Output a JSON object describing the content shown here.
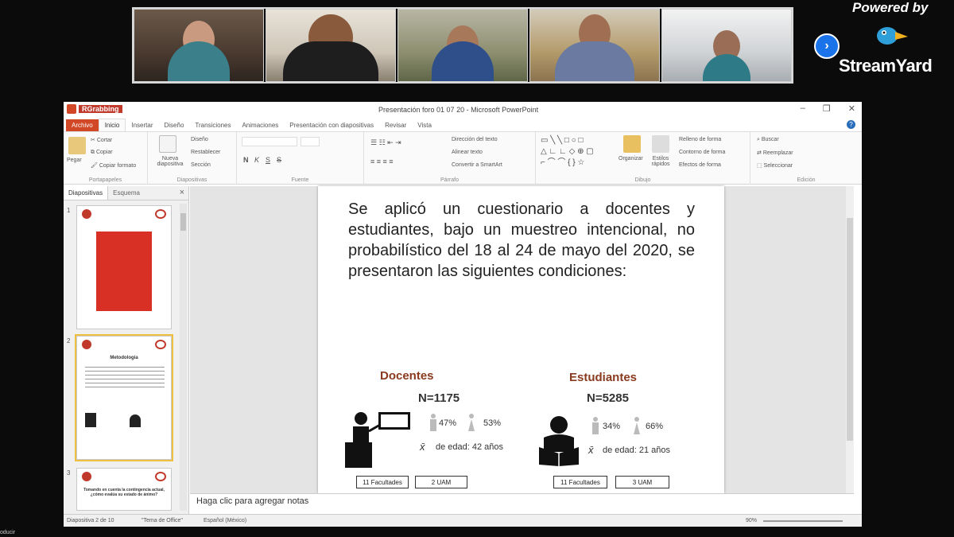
{
  "streamyard": {
    "powered_by": "Powered by",
    "brand": "StreamYard",
    "next_icon": "chevron-right-icon"
  },
  "participants": [
    {
      "name": ""
    },
    {
      "name": ""
    },
    {
      "name": ""
    },
    {
      "name": ""
    },
    {
      "name": ""
    }
  ],
  "ppt": {
    "window_title": "Presentación foro 01 07 20  -  Microsoft PowerPoint",
    "qat_tag": "RGrabbing",
    "tabs": [
      "Archivo",
      "Inicio",
      "Insertar",
      "Diseño",
      "Transiciones",
      "Animaciones",
      "Presentación con diapositivas",
      "Revisar",
      "Vista"
    ],
    "ribbon": {
      "clipboard": {
        "paste": "Pegar",
        "cut": "Cortar",
        "copy": "Copiar",
        "format": "Copiar formato",
        "label": "Portapapeles"
      },
      "slides": {
        "new": "Nueva diapositiva",
        "layout": "Diseño",
        "reset": "Restablecer",
        "section": "Sección",
        "label": "Diapositivas"
      },
      "font": {
        "label": "Fuente",
        "bold": "N",
        "italic": "K",
        "underline": "S",
        "strike": "S"
      },
      "paragraph": {
        "label": "Párrafo",
        "direction": "Dirección del texto",
        "align": "Alinear texto",
        "smartart": "Convertir a SmartArt"
      },
      "drawing": {
        "label": "Dibujo",
        "arrange": "Organizar",
        "styles": "Estilos rápidos",
        "fill": "Relleno de forma",
        "outline": "Contorno de forma",
        "effects": "Efectos de forma"
      },
      "editing": {
        "label": "Edición",
        "find": "Buscar",
        "replace": "Reemplazar",
        "select": "Seleccionar"
      }
    },
    "pane": {
      "tab_slides": "Diapositivas",
      "tab_outline": "Esquema",
      "close": "×",
      "thumbs": [
        {
          "num": "1"
        },
        {
          "num": "2",
          "title": "Metodología"
        },
        {
          "num": "3",
          "title": "Tomando en cuenta la contingencia actual, ¿cómo evalúa su estado de ánimo?"
        }
      ]
    },
    "slide": {
      "paragraph": "Se aplicó un cuestionario a docentes y estudiantes, bajo un muestreo intencional, no probabilístico del 18 al 24 de mayo del 2020, se presentaron las siguientes condiciones:",
      "docentes": {
        "title": "Docentes",
        "n": "N=1175",
        "pct_a": "47%",
        "pct_b": "53%",
        "age": "de edad: 42 años",
        "box1": "11 Facultades",
        "box2": "2 UAM"
      },
      "estudiantes": {
        "title": "Estudiantes",
        "n": "N=5285",
        "pct_a": "34%",
        "pct_b": "66%",
        "age": "de edad: 21 años",
        "box1": "11 Facultades",
        "box2": "3 UAM"
      },
      "xbar": "x̄"
    },
    "notes_placeholder": "Haga clic para agregar notas",
    "status": {
      "slide_of": "Diapositiva 2 de 10",
      "theme": "\"Tema de Office\"",
      "language": "Español (México)",
      "zoom": "90%"
    }
  },
  "corner_text": "oducir",
  "colors": {
    "accent": "#d24726",
    "brand_blue": "#1a73e8",
    "heading_brown": "#8a3a1e"
  }
}
